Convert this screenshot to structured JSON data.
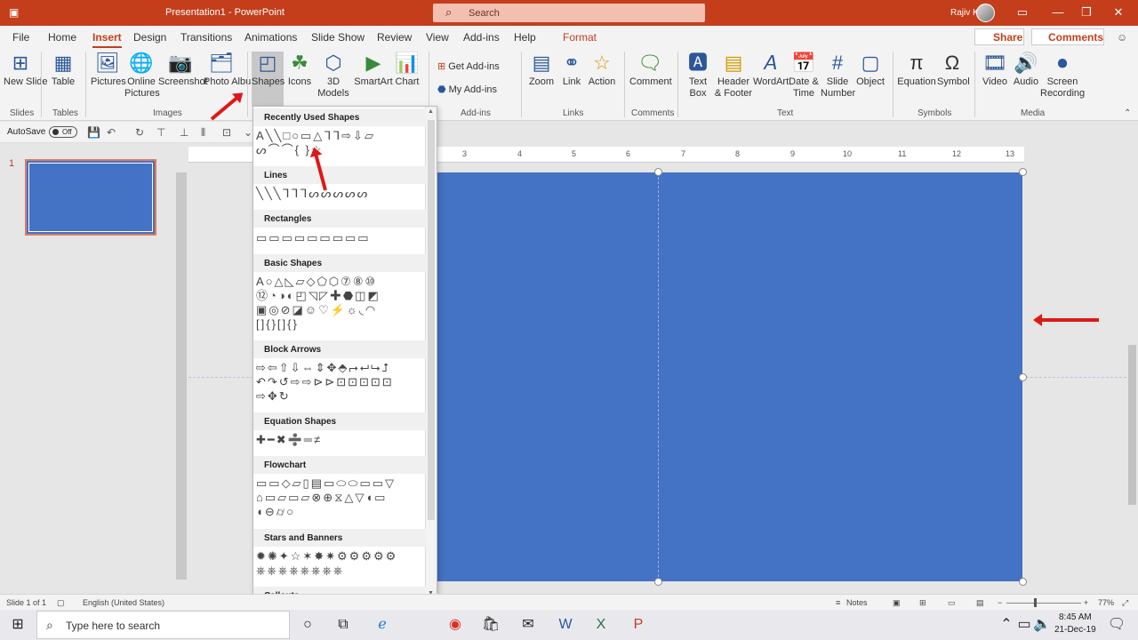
{
  "window": {
    "doc_title": "Presentation1  -  PowerPoint",
    "search_placeholder": "Search",
    "user_name": "Rajiv Kohli"
  },
  "tabs": [
    "File",
    "Home",
    "Insert",
    "Design",
    "Transitions",
    "Animations",
    "Slide Show",
    "Review",
    "View",
    "Add-ins",
    "Help",
    "Format"
  ],
  "active_tab": "Insert",
  "share_label": "Share",
  "comments_label": "Comments",
  "ribbon": {
    "new_slide": "New Slide",
    "table": "Table",
    "pictures": "Pictures",
    "online_pictures": "Online Pictures",
    "screenshot": "Screenshot",
    "photo_album": "Photo Album",
    "shapes": "Shapes",
    "icons": "Icons",
    "models_3d": "3D Models",
    "smartart": "SmartArt",
    "chart": "Chart",
    "get_addins": "Get Add-ins",
    "my_addins": "My Add-ins",
    "zoom": "Zoom",
    "link": "Link",
    "action": "Action",
    "comment": "Comment",
    "text_box": "Text Box",
    "header_footer": "Header & Footer",
    "wordart": "WordArt",
    "date_time": "Date & Time",
    "slide_number": "Slide Number",
    "object": "Object",
    "equation": "Equation",
    "symbol": "Symbol",
    "video": "Video",
    "audio": "Audio",
    "screen_recording": "Screen Recording",
    "groups": {
      "slides": "Slides",
      "tables": "Tables",
      "images": "Images",
      "addins": "Add-ins",
      "links": "Links",
      "comments": "Comments",
      "text": "Text",
      "symbols": "Symbols",
      "media": "Media"
    }
  },
  "autosave": {
    "label": "AutoSave",
    "state": "Off"
  },
  "slide_number": "1",
  "ruler_numbers": [
    "3",
    "4",
    "5",
    "6",
    "7",
    "8",
    "9",
    "10",
    "11",
    "12",
    "13"
  ],
  "shapes_menu": {
    "categories": [
      "Recently Used Shapes",
      "Lines",
      "Rectangles",
      "Basic Shapes",
      "Block Arrows",
      "Equation Shapes",
      "Flowchart",
      "Stars and Banners",
      "Callouts"
    ],
    "recent_rows": [
      "A╲╲□○▭△ᒣᒣ⇨⇩▱",
      "ᔕ⌒⌒{ }☆"
    ],
    "lines_row": "╲╲╲ᒣᒣᒣᔕᔕᔕᔕᔕ",
    "rect_row": "▭▭▭▭▭▭▭▭▭",
    "basic_rows": [
      "A○△◺▱◇⬠⬡⑦⑧⑩",
      "⑫◔◑◐◰◹◸✚⬣◫◩",
      "▣◎⊘◪☺♡⚡☼◟◠",
      "[]{}[]{}"
    ],
    "arrows_rows": [
      "⇨⇦⇧⇩⇔⇕✥⬘⮣⮠⮡⮥",
      "↶↷↺⇨⇨⊳⊳⊡⊡⊡⊡⊡",
      "⇨✥↻"
    ],
    "equation_row": "✚━✖➗═≠",
    "flow_rows": [
      "▭▭◇▱▯▤▭⬭⬭▭▭▽",
      "⌂▭▱▭▱⊗⊕⧖△▽◖▭",
      "◖⊖⌭○"
    ],
    "stars_rows": [
      "✹✺✦☆✶✸✷⚙⚙⚙⚙⚙",
      "⎈⎈⎈⎈⎈⎈⎈⎈"
    ]
  },
  "status": {
    "slide_of": "Slide 1 of 1",
    "language": "English (United States)",
    "notes": "Notes",
    "zoom": "77%"
  },
  "taskbar": {
    "search_placeholder": "Type here to search",
    "time": "8:45 AM",
    "date": "21-Dec-19"
  },
  "colors": {
    "accent": "#c43e1c",
    "slide_fill": "#4472c4",
    "annotation_arrow": "#e01818"
  }
}
